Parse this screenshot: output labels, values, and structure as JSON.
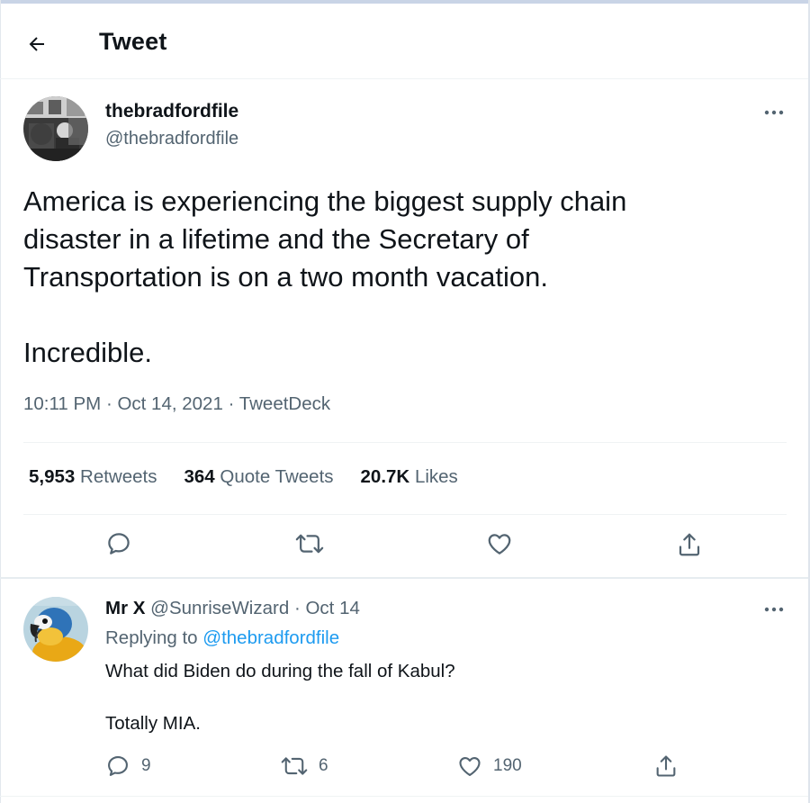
{
  "header": {
    "title": "Tweet",
    "back_icon": "arrow-left-icon"
  },
  "tweet": {
    "author": {
      "name": "thebradfordfile",
      "handle": "@thebradfordfile"
    },
    "text_lines": [
      "America is experiencing the biggest supply chain",
      "disaster in a lifetime and the Secretary of",
      "Transportation is on a two month vacation."
    ],
    "text_after": "Incredible.",
    "time": "10:11 PM",
    "separator": "·",
    "date": "Oct 14, 2021",
    "source": "TweetDeck",
    "stats": {
      "retweets_count": "5,953",
      "retweets_label": "Retweets",
      "quotes_count": "364",
      "quotes_label": "Quote Tweets",
      "likes_count": "20.7K",
      "likes_label": "Likes"
    },
    "actions": [
      "reply-icon",
      "retweet-icon",
      "like-icon",
      "share-icon"
    ]
  },
  "reply": {
    "name": "Mr X",
    "handle": "@SunriseWizard",
    "separator": "·",
    "date": "Oct 14",
    "replying_prefix": "Replying to",
    "replying_handle": "@thebradfordfile",
    "text_line1": "What did Biden do during the fall of Kabul?",
    "text_line2": "Totally MIA.",
    "counts": {
      "replies": "9",
      "retweets": "6",
      "likes": "190"
    }
  },
  "colors": {
    "accent": "#1d9bf0",
    "text": "#0f1419",
    "secondary": "#536471",
    "divider": "#eff3f4"
  }
}
